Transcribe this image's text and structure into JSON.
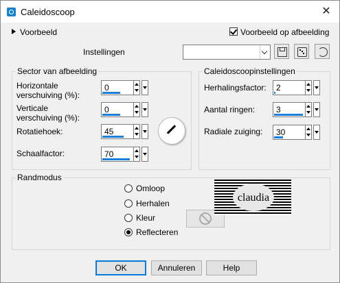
{
  "window": {
    "title": "Caleidoscoop"
  },
  "preview": {
    "label": "Voorbeeld",
    "checkbox_label": "Voorbeeld op afbeelding",
    "checked": true
  },
  "settings": {
    "label": "Instellingen",
    "value": ""
  },
  "sector": {
    "title": "Sector van afbeelding",
    "h_offset": {
      "label_line1": "Horizontale",
      "label_line2": "verschuiving (%):",
      "value": "0",
      "fill": 0.6
    },
    "v_offset": {
      "label_line1": "Verticale",
      "label_line2": "verschuiving (%):",
      "value": "0",
      "fill": 0.6
    },
    "rotation": {
      "label": "Rotatiehoek:",
      "value": "45",
      "fill": 0.7
    },
    "scale": {
      "label": "Schaalfactor:",
      "value": "70",
      "fill": 0.9
    }
  },
  "kaleido": {
    "title": "Caleidoscoopinstellingen",
    "repeat": {
      "label": "Herhalingsfactor:",
      "value": "2",
      "fill": 0.05
    },
    "rings": {
      "label": "Aantal ringen:",
      "value": "3",
      "fill": 0.95
    },
    "radial": {
      "label": "Radiale zuiging:",
      "value": "30",
      "fill": 0.3
    }
  },
  "edge": {
    "title": "Randmodus",
    "options": [
      {
        "label": "Omloop",
        "selected": false
      },
      {
        "label": "Herhalen",
        "selected": false
      },
      {
        "label": "Kleur",
        "selected": false
      },
      {
        "label": "Reflecteren",
        "selected": true
      }
    ],
    "watermark": "claudia"
  },
  "buttons": {
    "ok": "OK",
    "cancel": "Annuleren",
    "help": "Help"
  },
  "colors": {
    "accent": "#0078d7",
    "bar": "#1c7ed8",
    "icon": "#1683c9"
  }
}
